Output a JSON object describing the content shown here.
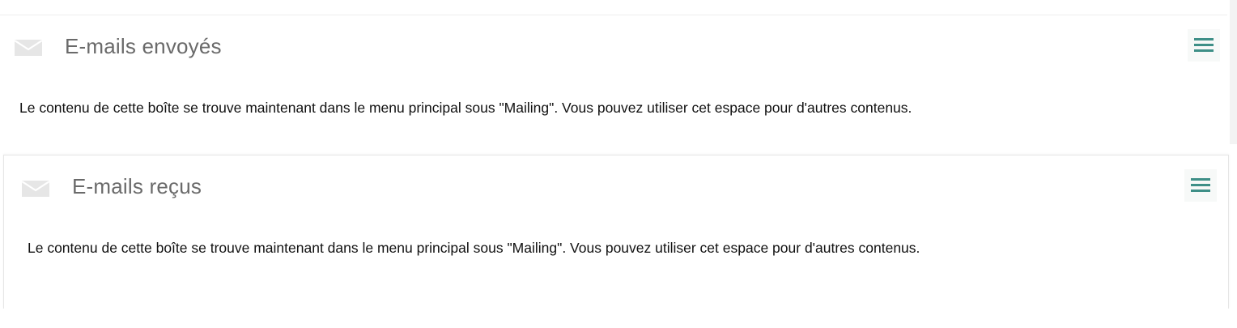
{
  "panels": [
    {
      "title": "E-mails envoyés",
      "icon": "envelope-icon",
      "menu_icon": "hamburger-menu-icon",
      "body": "Le contenu de cette boîte se trouve maintenant dans le menu principal sous \"Mailing\". Vous pouvez utiliser cet espace pour d'autres contenus."
    },
    {
      "title": "E-mails reçus",
      "icon": "envelope-icon",
      "menu_icon": "hamburger-menu-icon",
      "body": "Le contenu de cette boîte se trouve maintenant dans le menu principal sous \"Mailing\". Vous pouvez utiliser cet espace pour d'autres contenus."
    }
  ],
  "colors": {
    "title_text": "#6a6a6a",
    "body_text": "#111111",
    "menu_icon": "#3e8f87",
    "mail_icon": "#e6e6e6",
    "panel_border": "#e6e6e6"
  }
}
